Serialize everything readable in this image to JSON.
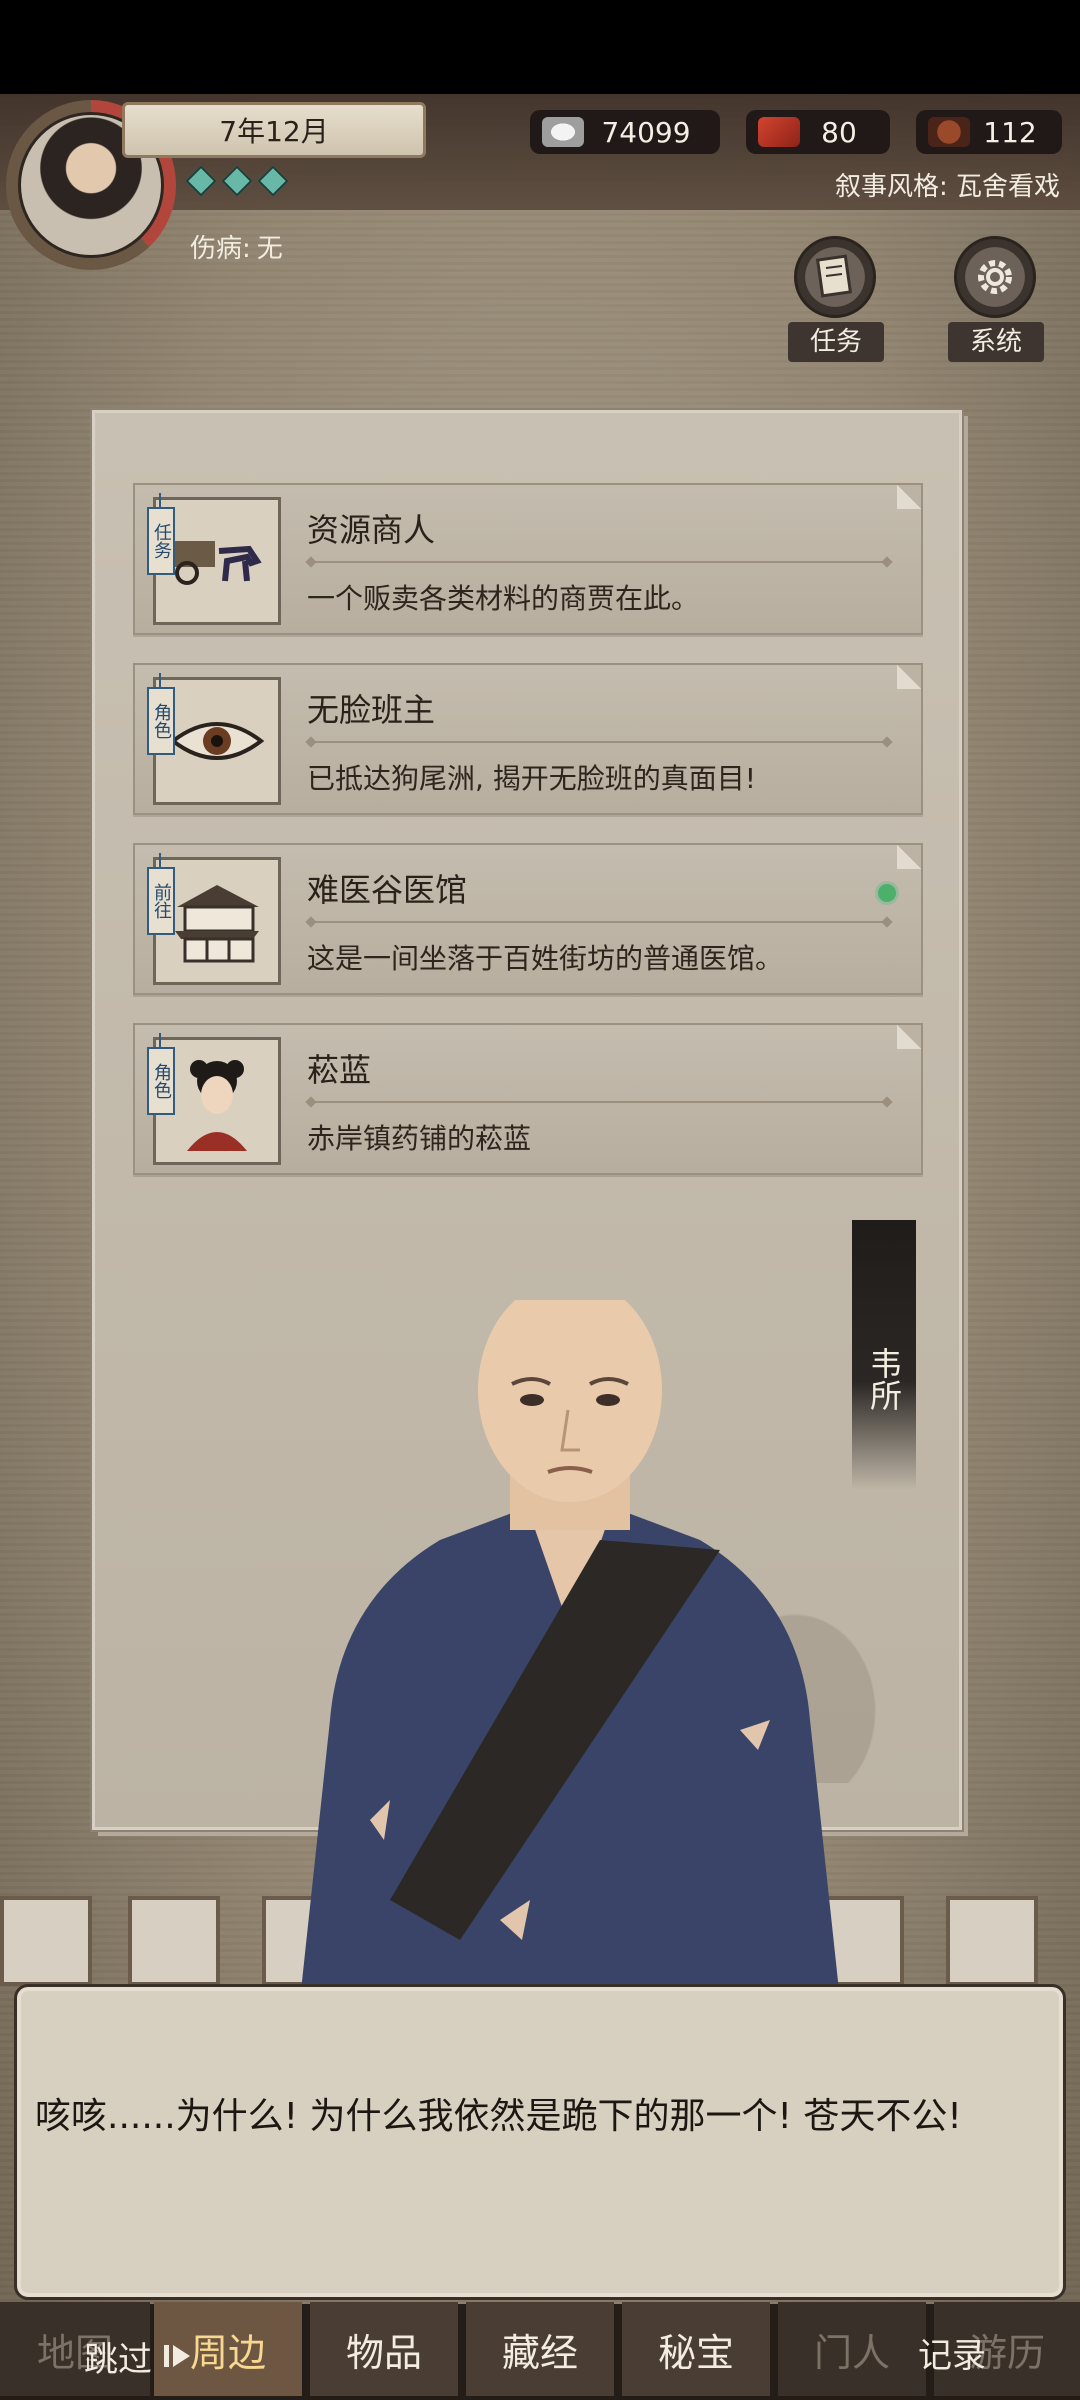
{
  "header": {
    "date": "7年12月",
    "injury_label": "伤病:",
    "injury_value": "无",
    "resources": [
      {
        "icon": "silver-ingot-icon",
        "value": "74099"
      },
      {
        "icon": "red-banner-icon",
        "value": "80"
      },
      {
        "icon": "seal-token-icon",
        "value": "112"
      }
    ],
    "narrative_style": "叙事风格: 瓦舍看戏",
    "buttons": {
      "task": "任务",
      "system": "系统"
    }
  },
  "cards": [
    {
      "tag": "任务",
      "title": "资源商人",
      "desc": "一个贩卖各类材料的商贾在此。",
      "thumb": "horse-cart-icon",
      "pinned": false
    },
    {
      "tag": "角色",
      "title": "无脸班主",
      "desc": "已抵达狗尾洲, 揭开无脸班的真面目!",
      "thumb": "eye-icon",
      "pinned": false
    },
    {
      "tag": "前往",
      "title": "难医谷医馆",
      "desc": "这是一间坐落于百姓街坊的普通医馆。",
      "thumb": "building-icon",
      "pinned": true
    },
    {
      "tag": "角色",
      "title": "菘蓝",
      "desc": "赤岸镇药铺的菘蓝",
      "thumb": "girl-portrait-icon",
      "pinned": false
    }
  ],
  "speaker_name": "韦所",
  "dialog_text": "咳咳......为什么! 为什么我依然是跪下的那一个! 苍天不公!",
  "tabs": [
    "地图",
    "周边",
    "物品",
    "藏经",
    "秘宝",
    "门人",
    "游历"
  ],
  "active_tab": "周边",
  "skip_label": "跳过",
  "record_label": "记录",
  "colors": {
    "accent_green": "#4caf6a",
    "tag_blue": "#335b7d",
    "active_tab": "#f8d890"
  }
}
